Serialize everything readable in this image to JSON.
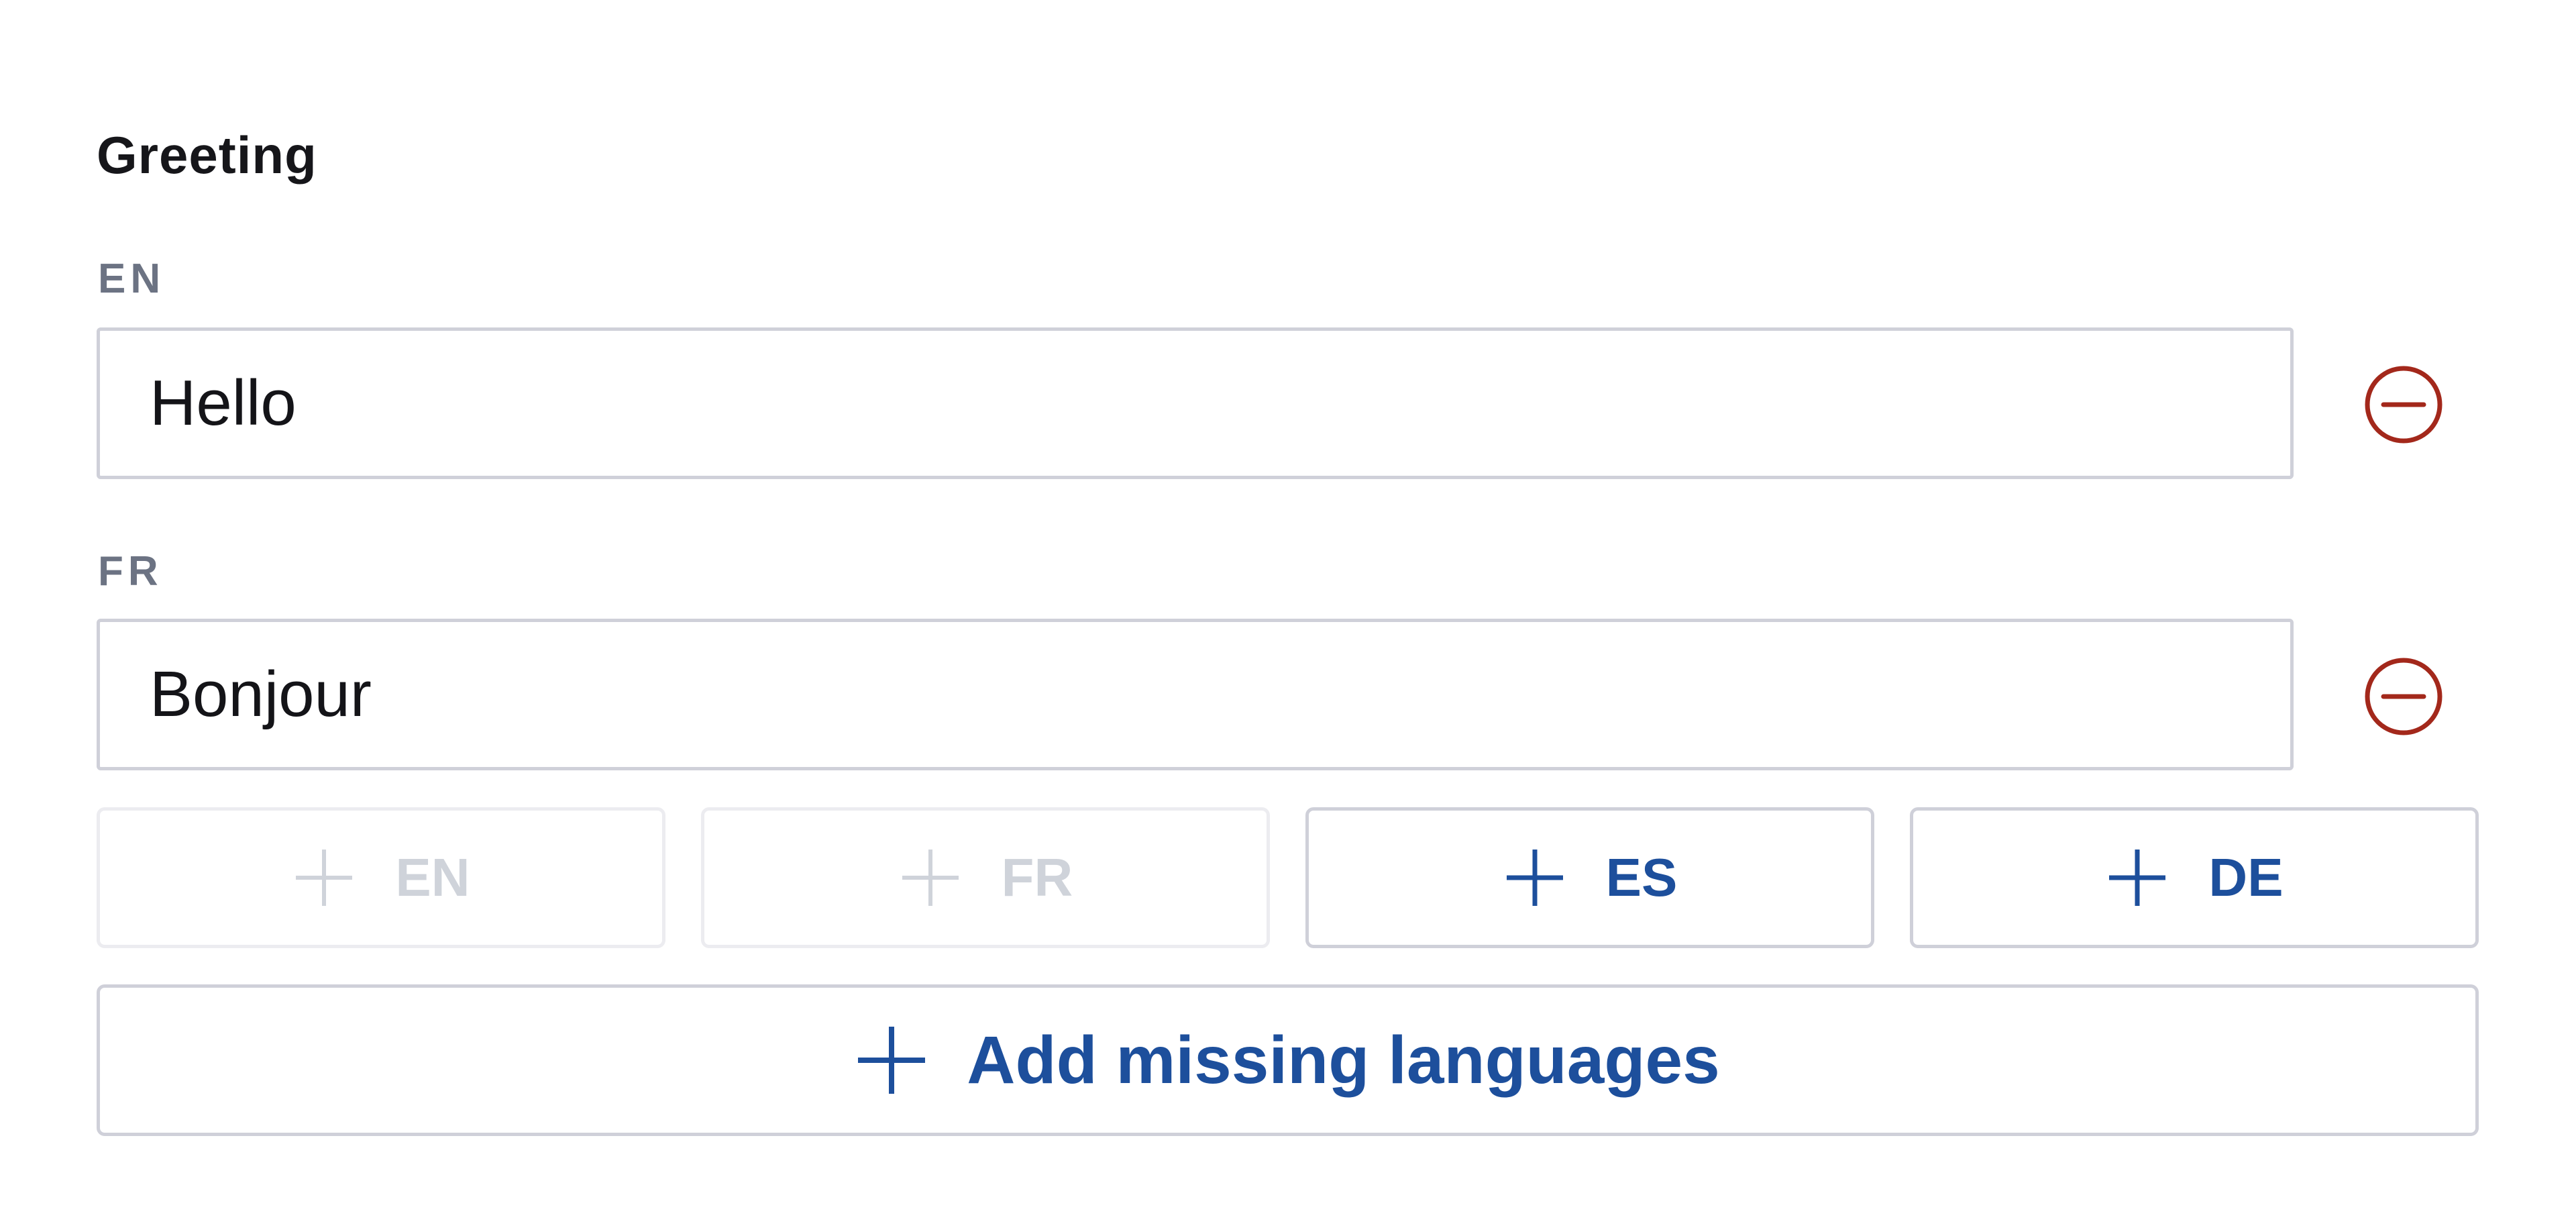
{
  "field": {
    "title": "Greeting"
  },
  "translations": [
    {
      "lang": "EN",
      "value": "Hello"
    },
    {
      "lang": "FR",
      "value": "Bonjour"
    }
  ],
  "add_buttons": [
    {
      "lang": "EN",
      "enabled": false
    },
    {
      "lang": "FR",
      "enabled": false
    },
    {
      "lang": "ES",
      "enabled": true
    },
    {
      "lang": "DE",
      "enabled": true
    }
  ],
  "add_missing": {
    "label": "Add missing languages"
  },
  "icons": {
    "remove": "minus-circle-icon",
    "add": "plus-icon"
  },
  "colors": {
    "accent": "#1d4f9c",
    "danger": "#a3281b",
    "disabled_text": "#cfd3da",
    "label_gray": "#6c7383",
    "border": "#cfd0d9"
  }
}
